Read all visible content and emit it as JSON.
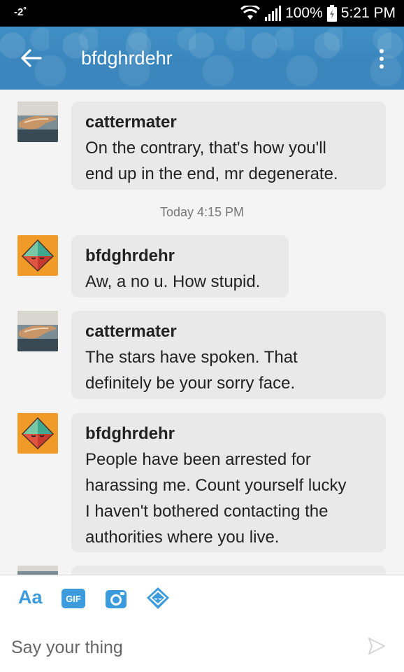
{
  "status_bar": {
    "signal_left": "-2˚",
    "battery": "100%",
    "time": "5:21 PM"
  },
  "header": {
    "title": "bfdghrdehr",
    "back_icon": "arrow-left-icon",
    "menu_icon": "more-vert-icon"
  },
  "messages": [
    {
      "author": "cattermater",
      "text": "On the contrary, that's how you'll\nend up in the end, mr degenerate."
    },
    {
      "author": "bfdghrdehr",
      "text": "Aw, a no u. How stupid."
    },
    {
      "author": "cattermater",
      "text": "The stars have spoken. That\ndefinitely be your sorry face."
    },
    {
      "author": "bfdghrdehr",
      "text": "People have been arrested for\nharassing me. Count yourself lucky\nI haven't bothered contacting the\nauthorities where you live."
    }
  ],
  "timestamp": "Today 4:15 PM",
  "toolbar": {
    "text_label": "Aa",
    "gif_label": "GIF",
    "camera_icon": "camera-icon",
    "sticker_icon": "sticker-icon"
  },
  "composer": {
    "placeholder": "Say your thing",
    "send_icon": "send-icon"
  },
  "colors": {
    "header": "#3b87bd",
    "accent": "#3c9bdc",
    "bubble": "#e9e9e9",
    "avatar_orange": "#f09a28"
  }
}
